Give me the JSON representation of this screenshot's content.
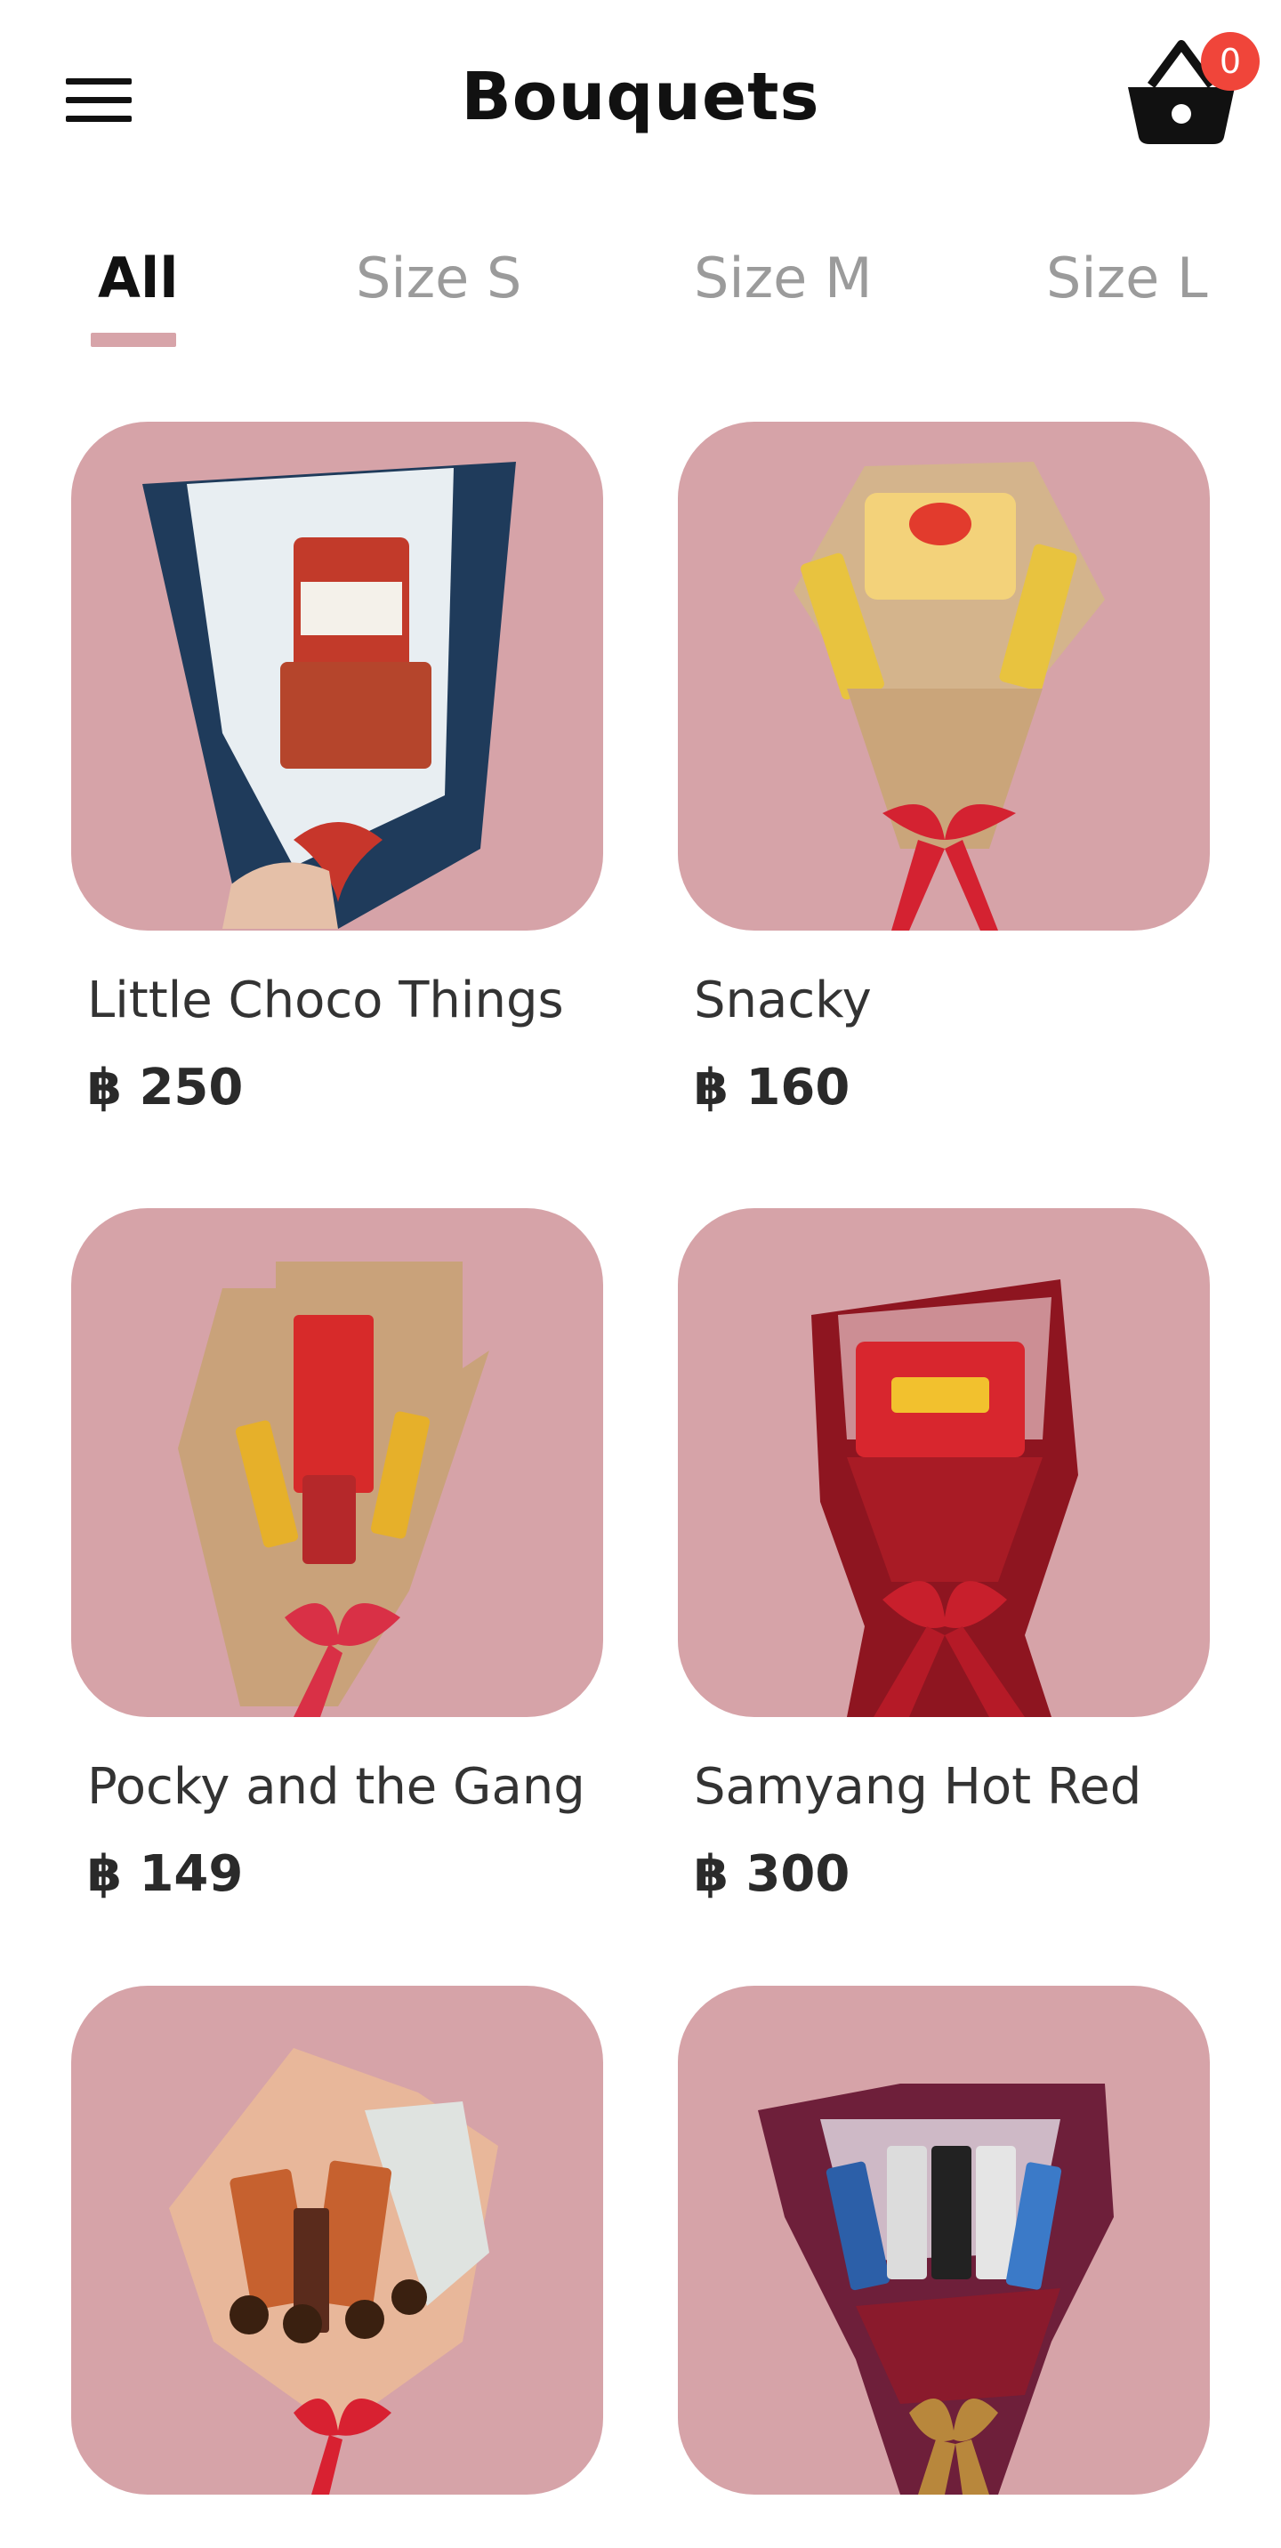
{
  "header": {
    "title": "Bouquets",
    "cart_count": "0"
  },
  "tabs": [
    {
      "label": "All",
      "active": true
    },
    {
      "label": "Size S",
      "active": false
    },
    {
      "label": "Size M",
      "active": false
    },
    {
      "label": "Size L",
      "active": false
    }
  ],
  "products": [
    {
      "name": "Little Choco Things",
      "price": "฿ 250"
    },
    {
      "name": "Snacky",
      "price": "฿ 160"
    },
    {
      "name": "Pocky and the Gang",
      "price": "฿ 149"
    },
    {
      "name": "Samyang Hot Red",
      "price": "฿ 300"
    },
    {
      "name": "",
      "price": ""
    },
    {
      "name": "",
      "price": ""
    }
  ],
  "colors": {
    "accent": "#d7a4a9",
    "card_bg": "#d6a3a8",
    "badge": "#f0453a"
  },
  "icons": {
    "menu": "hamburger-icon",
    "cart": "basket-icon"
  }
}
